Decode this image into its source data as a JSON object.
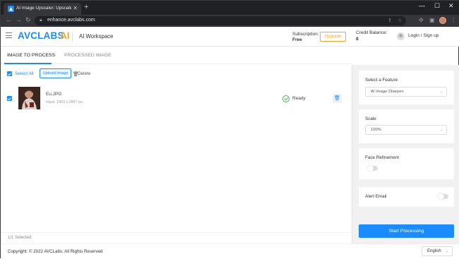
{
  "browser": {
    "tab_title": "AI Image Upscaler: Upscale Imag...",
    "url": "enhance.avclabs.com"
  },
  "header": {
    "logo_text": "AVCLABS",
    "logo_ai": "AI",
    "workspace": "AI Workspace",
    "subscription_label": "Subscription:",
    "subscription_value": "Free",
    "upgrade_label": "Upgrade",
    "credit_label": "Credit Balance:",
    "credit_value": "8",
    "login_label": "Login / Sign up"
  },
  "tabs": [
    {
      "label": "IMAGE TO PROCESS",
      "active": true
    },
    {
      "label": "PROCESSED IMAGE",
      "active": false
    }
  ],
  "actions": {
    "select_all": "Select All",
    "upload": "Upload Image",
    "delete": "Delete"
  },
  "files": [
    {
      "name": "Eu.JPG",
      "meta": "Input: 1953 x 2857 px",
      "status": "Ready"
    }
  ],
  "footer": {
    "selected": "1/1 Selected",
    "copyright": "Copyright: © 2022 AVCLabs. All Rights Reserved",
    "language": "English"
  },
  "settings": {
    "feature_label": "Select a Feature",
    "feature_value": "AI Image Sharpen",
    "scale_label": "Scale",
    "scale_value": "100%",
    "face_label": "Face Refinement",
    "face_enabled": false,
    "alert_label": "Alert Email",
    "alert_enabled": false,
    "start_label": "Start Processing"
  },
  "colors": {
    "accent": "#1a8cff",
    "brand_ai": "#f5a623",
    "ready": "#46b34a"
  }
}
